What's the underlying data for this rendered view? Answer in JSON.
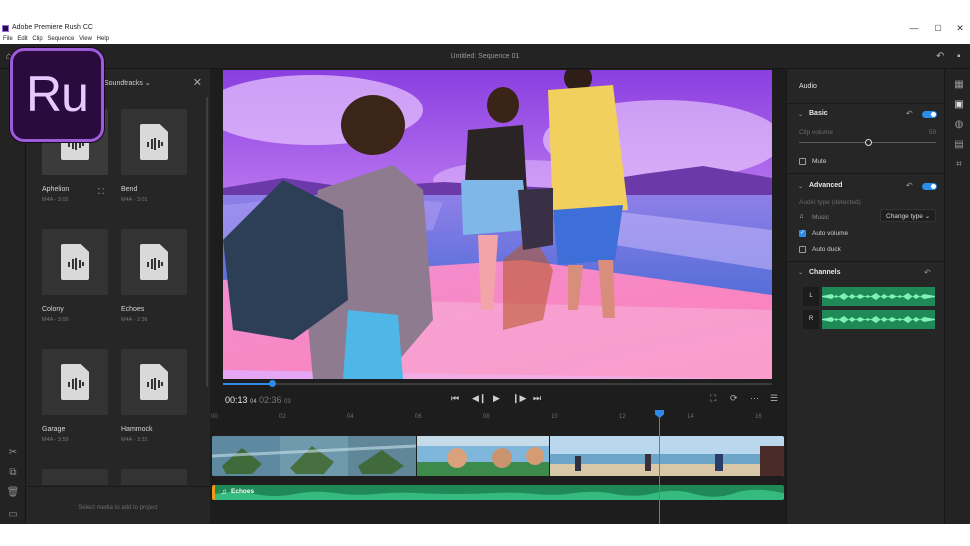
{
  "window": {
    "title": "Adobe Premiere Rush CC",
    "minimize": "—",
    "maximize": "▢",
    "close": "✕"
  },
  "menu": [
    "File",
    "Edit",
    "Clip",
    "Sequence",
    "View",
    "Help"
  ],
  "logo_text": "Ru",
  "sequence_title": "Untitled: Sequence 01",
  "media_panel": {
    "title": "Soundtracks",
    "items": [
      {
        "name": "Aphelion",
        "meta": "M4A - 3:02"
      },
      {
        "name": "Bend",
        "meta": "M4A - 3:01"
      },
      {
        "name": "Colony",
        "meta": "M4A - 3:00"
      },
      {
        "name": "Echoes",
        "meta": "M4A - 2:36"
      },
      {
        "name": "Garage",
        "meta": "M4A - 3:59"
      },
      {
        "name": "Hammock",
        "meta": "M4A - 3:32"
      }
    ],
    "footer": "Select media to add to project"
  },
  "preview": {
    "current_time": "00:13",
    "current_frames": "04",
    "total_time": "02:36",
    "total_frames": "03",
    "progress": 0.09
  },
  "timeline": {
    "ticks": [
      "00",
      "02",
      "04",
      "06",
      "08",
      "10",
      "12",
      "14",
      "16"
    ],
    "audio_clip": "Echoes"
  },
  "audio_panel": {
    "title": "Audio",
    "basic": {
      "label": "Basic",
      "clip_volume_label": "Clip volume",
      "clip_volume_value": "50",
      "volume_level": 0.5,
      "mute_label": "Mute",
      "mute_checked": false
    },
    "advanced": {
      "label": "Advanced",
      "audio_type_label": "Audio type (detected)",
      "music_label": "Music",
      "change_type_label": "Change type",
      "auto_volume_label": "Auto volume",
      "auto_volume_checked": true,
      "auto_duck_label": "Auto duck",
      "auto_duck_checked": false
    },
    "channels": {
      "label": "Channels",
      "left": "L",
      "right": "R"
    }
  },
  "colors": {
    "accent": "#2d8ceb",
    "audio_green": "#1f8a57",
    "clip_marker": "#f29a16",
    "logo_purple": "#9c5cd8"
  }
}
